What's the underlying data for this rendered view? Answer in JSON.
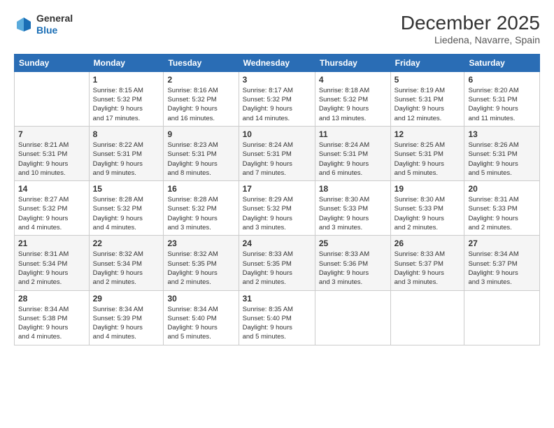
{
  "header": {
    "logo": {
      "general": "General",
      "blue": "Blue"
    },
    "title": "December 2025",
    "location": "Liedena, Navarre, Spain"
  },
  "weekdays": [
    "Sunday",
    "Monday",
    "Tuesday",
    "Wednesday",
    "Thursday",
    "Friday",
    "Saturday"
  ],
  "weeks": [
    [
      {
        "day": "",
        "info": ""
      },
      {
        "day": "1",
        "info": "Sunrise: 8:15 AM\nSunset: 5:32 PM\nDaylight: 9 hours\nand 17 minutes."
      },
      {
        "day": "2",
        "info": "Sunrise: 8:16 AM\nSunset: 5:32 PM\nDaylight: 9 hours\nand 16 minutes."
      },
      {
        "day": "3",
        "info": "Sunrise: 8:17 AM\nSunset: 5:32 PM\nDaylight: 9 hours\nand 14 minutes."
      },
      {
        "day": "4",
        "info": "Sunrise: 8:18 AM\nSunset: 5:32 PM\nDaylight: 9 hours\nand 13 minutes."
      },
      {
        "day": "5",
        "info": "Sunrise: 8:19 AM\nSunset: 5:31 PM\nDaylight: 9 hours\nand 12 minutes."
      },
      {
        "day": "6",
        "info": "Sunrise: 8:20 AM\nSunset: 5:31 PM\nDaylight: 9 hours\nand 11 minutes."
      }
    ],
    [
      {
        "day": "7",
        "info": "Sunrise: 8:21 AM\nSunset: 5:31 PM\nDaylight: 9 hours\nand 10 minutes."
      },
      {
        "day": "8",
        "info": "Sunrise: 8:22 AM\nSunset: 5:31 PM\nDaylight: 9 hours\nand 9 minutes."
      },
      {
        "day": "9",
        "info": "Sunrise: 8:23 AM\nSunset: 5:31 PM\nDaylight: 9 hours\nand 8 minutes."
      },
      {
        "day": "10",
        "info": "Sunrise: 8:24 AM\nSunset: 5:31 PM\nDaylight: 9 hours\nand 7 minutes."
      },
      {
        "day": "11",
        "info": "Sunrise: 8:24 AM\nSunset: 5:31 PM\nDaylight: 9 hours\nand 6 minutes."
      },
      {
        "day": "12",
        "info": "Sunrise: 8:25 AM\nSunset: 5:31 PM\nDaylight: 9 hours\nand 5 minutes."
      },
      {
        "day": "13",
        "info": "Sunrise: 8:26 AM\nSunset: 5:31 PM\nDaylight: 9 hours\nand 5 minutes."
      }
    ],
    [
      {
        "day": "14",
        "info": "Sunrise: 8:27 AM\nSunset: 5:32 PM\nDaylight: 9 hours\nand 4 minutes."
      },
      {
        "day": "15",
        "info": "Sunrise: 8:28 AM\nSunset: 5:32 PM\nDaylight: 9 hours\nand 4 minutes."
      },
      {
        "day": "16",
        "info": "Sunrise: 8:28 AM\nSunset: 5:32 PM\nDaylight: 9 hours\nand 3 minutes."
      },
      {
        "day": "17",
        "info": "Sunrise: 8:29 AM\nSunset: 5:32 PM\nDaylight: 9 hours\nand 3 minutes."
      },
      {
        "day": "18",
        "info": "Sunrise: 8:30 AM\nSunset: 5:33 PM\nDaylight: 9 hours\nand 3 minutes."
      },
      {
        "day": "19",
        "info": "Sunrise: 8:30 AM\nSunset: 5:33 PM\nDaylight: 9 hours\nand 2 minutes."
      },
      {
        "day": "20",
        "info": "Sunrise: 8:31 AM\nSunset: 5:33 PM\nDaylight: 9 hours\nand 2 minutes."
      }
    ],
    [
      {
        "day": "21",
        "info": "Sunrise: 8:31 AM\nSunset: 5:34 PM\nDaylight: 9 hours\nand 2 minutes."
      },
      {
        "day": "22",
        "info": "Sunrise: 8:32 AM\nSunset: 5:34 PM\nDaylight: 9 hours\nand 2 minutes."
      },
      {
        "day": "23",
        "info": "Sunrise: 8:32 AM\nSunset: 5:35 PM\nDaylight: 9 hours\nand 2 minutes."
      },
      {
        "day": "24",
        "info": "Sunrise: 8:33 AM\nSunset: 5:35 PM\nDaylight: 9 hours\nand 2 minutes."
      },
      {
        "day": "25",
        "info": "Sunrise: 8:33 AM\nSunset: 5:36 PM\nDaylight: 9 hours\nand 3 minutes."
      },
      {
        "day": "26",
        "info": "Sunrise: 8:33 AM\nSunset: 5:37 PM\nDaylight: 9 hours\nand 3 minutes."
      },
      {
        "day": "27",
        "info": "Sunrise: 8:34 AM\nSunset: 5:37 PM\nDaylight: 9 hours\nand 3 minutes."
      }
    ],
    [
      {
        "day": "28",
        "info": "Sunrise: 8:34 AM\nSunset: 5:38 PM\nDaylight: 9 hours\nand 4 minutes."
      },
      {
        "day": "29",
        "info": "Sunrise: 8:34 AM\nSunset: 5:39 PM\nDaylight: 9 hours\nand 4 minutes."
      },
      {
        "day": "30",
        "info": "Sunrise: 8:34 AM\nSunset: 5:40 PM\nDaylight: 9 hours\nand 5 minutes."
      },
      {
        "day": "31",
        "info": "Sunrise: 8:35 AM\nSunset: 5:40 PM\nDaylight: 9 hours\nand 5 minutes."
      },
      {
        "day": "",
        "info": ""
      },
      {
        "day": "",
        "info": ""
      },
      {
        "day": "",
        "info": ""
      }
    ]
  ]
}
